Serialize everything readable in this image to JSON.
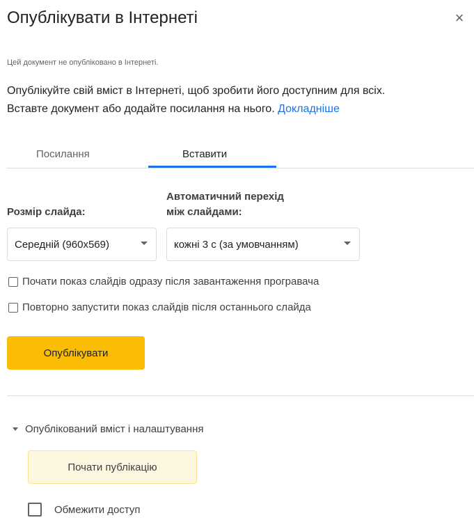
{
  "dialog": {
    "title": "Опублікувати в Інтернеті",
    "close_icon": "×",
    "status": "Цей документ не опубліковано в Інтернеті.",
    "description_line1": "Опублікуйте свій вміст в Інтернеті, щоб зробити його доступним для всіх.",
    "description_line2": "Вставте документ або додайте посилання на нього.",
    "learn_more": "Докладніше"
  },
  "tabs": [
    {
      "label": "Посилання",
      "active": false
    },
    {
      "label": "Вставити",
      "active": true
    }
  ],
  "embed": {
    "slide_size_label": "Розмір слайда:",
    "slide_size_value": "Середній (960x569)",
    "auto_advance_label_line1": "Автоматичний перехід",
    "auto_advance_label_line2": "між слайдами:",
    "auto_advance_value": "кожні 3 с (за умовчанням)",
    "start_on_load_label": "Почати показ слайдів одразу після завантаження програвача",
    "start_on_load_checked": false,
    "restart_label": "Повторно запустити показ слайдів після останнього слайда",
    "restart_checked": false
  },
  "publish_button": "Опублікувати",
  "published_settings": {
    "section_label": "Опублікований вміст і налаштування",
    "start_publishing_button": "Почати публікацію",
    "restrict_access_label": "Обмежити доступ",
    "restrict_access_checked": false
  },
  "colors": {
    "accent": "#1a73e8",
    "publish_button": "#fbbc04",
    "start_button_bg": "#fef7e0"
  }
}
